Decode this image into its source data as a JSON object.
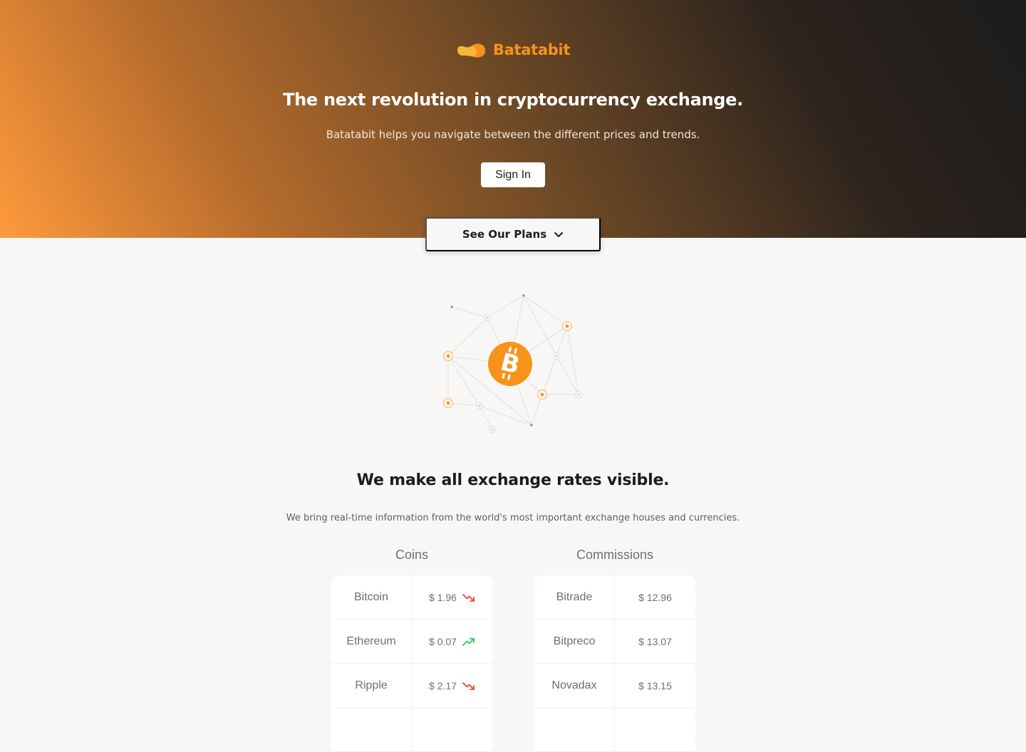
{
  "brand": {
    "name": "Batatabit",
    "accent": "#f7931a"
  },
  "hero": {
    "title": "The next revolution in cryptocurrency exchange.",
    "subtitle": "Batatabit helps you navigate between the different prices and trends.",
    "signin_label": "Sign In",
    "plans_label": "See Our Plans"
  },
  "exchange": {
    "title": "We make all exchange rates visible.",
    "subtitle": "We bring real-time information from the world's most important exchange houses and currencies.",
    "coins": {
      "caption": "Coins",
      "rows": [
        {
          "name": "Bitcoin",
          "value": "$ 1.96",
          "trend": "down"
        },
        {
          "name": "Ethereum",
          "value": "$ 0.07",
          "trend": "up"
        },
        {
          "name": "Ripple",
          "value": "$ 2.17",
          "trend": "down"
        }
      ]
    },
    "commissions": {
      "caption": "Commissions",
      "rows": [
        {
          "name": "Bitrade",
          "value": "$ 12.96"
        },
        {
          "name": "Bitpreco",
          "value": "$ 13.07"
        },
        {
          "name": "Novadax",
          "value": "$ 13.15"
        }
      ]
    }
  },
  "colors": {
    "trend_up": "#2ecc40",
    "trend_down": "#e8472b",
    "bitcoin": "#f7931a"
  }
}
